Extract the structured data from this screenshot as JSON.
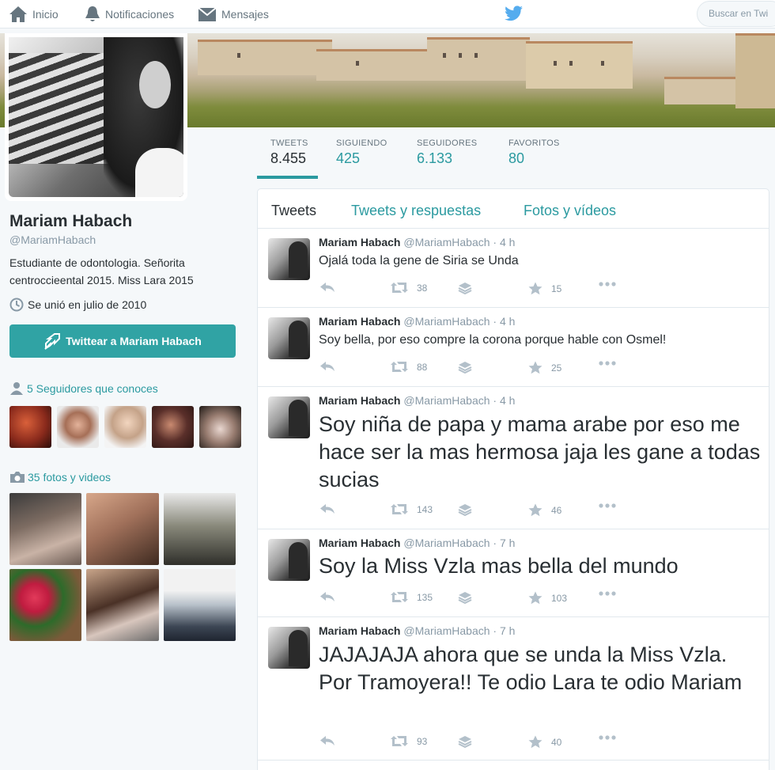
{
  "nav": {
    "home": "Inicio",
    "notifications": "Notificaciones",
    "messages": "Mensajes",
    "search_placeholder": "Buscar en Twi"
  },
  "profile": {
    "name": "Mariam Habach",
    "handle": "@MariamHabach",
    "bio": "Estudiante de odontologia. Señorita centroccieental 2015. Miss Lara 2015",
    "joined": "Se unió en julio de 2010",
    "tweet_to_button": "Twittear a Mariam Habach",
    "followers_you_know": "5 Seguidores que conoces",
    "photos_videos": "35 fotos y videos"
  },
  "stats": [
    {
      "label": "TWEETS",
      "value": "8.455"
    },
    {
      "label": "SIGUIENDO",
      "value": "425"
    },
    {
      "label": "SEGUIDORES",
      "value": "6.133"
    },
    {
      "label": "FAVORITOS",
      "value": "80"
    }
  ],
  "tabs": [
    "Tweets",
    "Tweets y respuestas",
    "Fotos y vídeos"
  ],
  "tweets": [
    {
      "name": "Mariam Habach",
      "handle": "@MariamHabach",
      "time": "· 4 h",
      "text": "Ojalá toda la gene de Siria se Unda",
      "retweets": "38",
      "favorites": "15"
    },
    {
      "name": "Mariam Habach",
      "handle": "@MariamHabach",
      "time": "· 4 h",
      "text": "Soy bella, por eso compre la corona porque hable con Osmel!",
      "retweets": "88",
      "favorites": "25"
    },
    {
      "name": "Mariam Habach",
      "handle": "@MariamHabach",
      "time": "· 4 h",
      "text": "Soy niña de papa y mama arabe por eso me hace ser la mas hermosa jaja les gane a todas sucias",
      "retweets": "143",
      "favorites": "46"
    },
    {
      "name": "Mariam Habach",
      "handle": "@MariamHabach",
      "time": "· 7 h",
      "text": "Soy la Miss Vzla mas bella del mundo",
      "retweets": "135",
      "favorites": "103"
    },
    {
      "name": "Mariam Habach",
      "handle": "@MariamHabach",
      "time": "· 7 h",
      "text": "JAJAJAJA ahora que se unda la Miss Vzla. Por Tramoyera!! Te odio Lara te odio Mariam",
      "retweets": "93",
      "favorites": "40"
    }
  ],
  "colors": {
    "accent": "#2b9aa0",
    "button": "#30a3a4",
    "twitter_blue": "#55acee"
  }
}
